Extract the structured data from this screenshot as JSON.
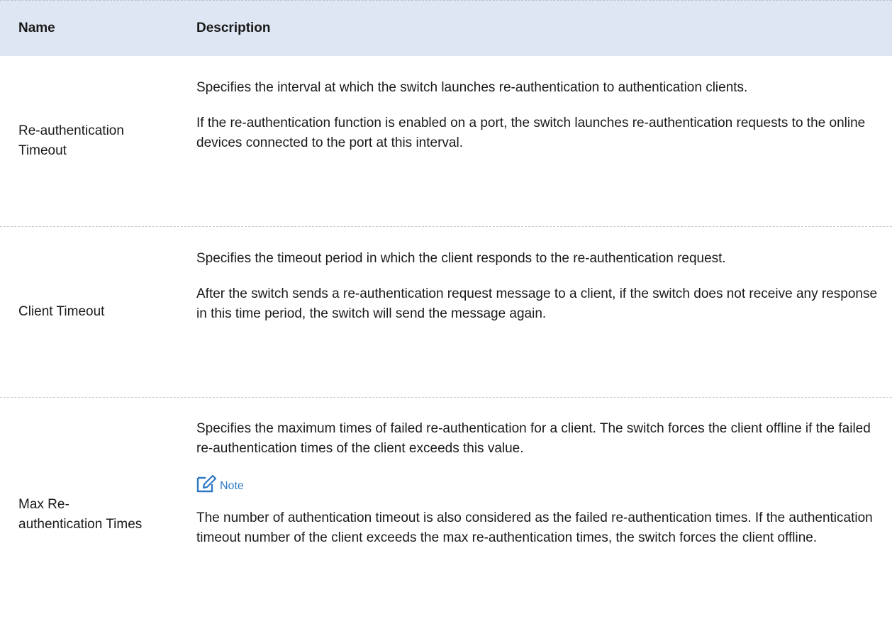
{
  "table": {
    "header": {
      "name": "Name",
      "description": "Description"
    },
    "rows": [
      {
        "name_lines": [
          "Re-authentication",
          "Timeout"
        ],
        "paragraphs": [
          "Specifies the interval at which the switch launches re-authentication to authentication clients.",
          "If the re-authentication function is enabled on a port, the switch launches re-authentication requests to the online devices connected to the port at this interval."
        ]
      },
      {
        "name_lines": [
          "Client Timeout"
        ],
        "paragraphs": [
          "Specifies the timeout period in which the client responds to the re-authentication request.",
          "After the switch sends a re-authentication request message to a client, if the switch does not receive any response in this time period, the switch will send the message again."
        ]
      },
      {
        "name_lines": [
          "Max Re-",
          "authentication Times"
        ],
        "paragraphs": [
          "Specifies the maximum times of failed re-authentication for a client. The switch forces the client offline if the failed re-authentication times of the client exceeds this value."
        ],
        "note": {
          "label": "Note",
          "icon": "note-edit-icon",
          "text": "The number of authentication timeout is also considered as the failed re-authentication times. If the authentication timeout number of the client exceeds the max re-authentication times, the switch forces the client offline."
        }
      }
    ]
  },
  "colors": {
    "header_bg": "#dde6f2",
    "note_accent": "#2f78c4"
  }
}
